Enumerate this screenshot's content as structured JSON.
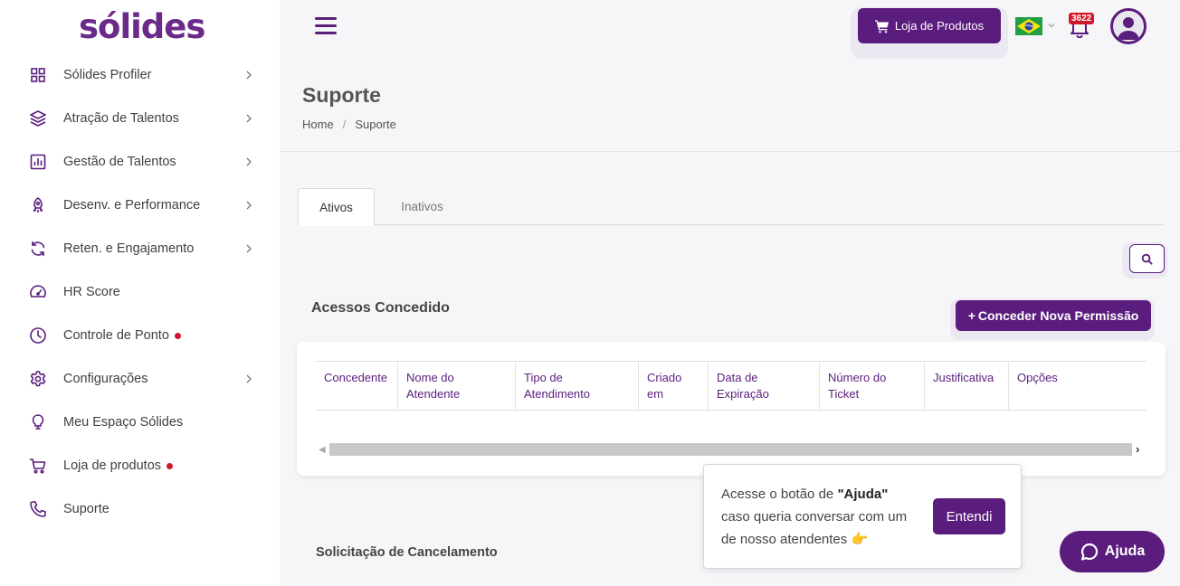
{
  "brand": {
    "logo_text": "sólides",
    "accent": "#5b1d7d"
  },
  "sidebar": {
    "items": [
      {
        "label": "Sólides Profiler",
        "icon": "grid-icon",
        "has_submenu": true
      },
      {
        "label": "Atração de Talentos",
        "icon": "layers-icon",
        "has_submenu": true
      },
      {
        "label": "Gestão de Talentos",
        "icon": "bar-chart-icon",
        "has_submenu": true
      },
      {
        "label": "Desenv. e Performance",
        "icon": "rocket-icon",
        "has_submenu": true
      },
      {
        "label": "Reten. e Engajamento",
        "icon": "refresh-icon",
        "has_submenu": true
      },
      {
        "label": "HR Score",
        "icon": "gauge-icon",
        "has_submenu": false
      },
      {
        "label": "Controle de Ponto",
        "icon": "clock-icon",
        "has_submenu": false,
        "dot": true
      },
      {
        "label": "Configurações",
        "icon": "gear-icon",
        "has_submenu": true
      },
      {
        "label": "Meu Espaço Sólides",
        "icon": "lightbulb-icon",
        "has_submenu": false
      },
      {
        "label": "Loja de produtos",
        "icon": "cart-icon",
        "has_submenu": false,
        "dot": true
      },
      {
        "label": "Suporte",
        "icon": "phone-icon",
        "has_submenu": false
      }
    ]
  },
  "topbar": {
    "shop_label": "Loja de Produtos",
    "notification_count": "3622"
  },
  "header": {
    "title": "Suporte",
    "breadcrumb": [
      "Home",
      "Suporte"
    ]
  },
  "tabs": [
    {
      "label": "Ativos",
      "active": true
    },
    {
      "label": "Inativos",
      "active": false
    }
  ],
  "access": {
    "title": "Acessos Concedido",
    "grant_label": "Conceder Nova Permissão",
    "columns": [
      {
        "l1": "Concedente",
        "l2": ""
      },
      {
        "l1": "Nome do",
        "l2": "Atendente"
      },
      {
        "l1": "Tipo de",
        "l2": "Atendimento"
      },
      {
        "l1": "Criado",
        "l2": "em"
      },
      {
        "l1": "Data de",
        "l2": "Expiração"
      },
      {
        "l1": "Número do",
        "l2": "Ticket"
      },
      {
        "l1": "Justificativa",
        "l2": ""
      },
      {
        "l1": "Opções",
        "l2": ""
      }
    ]
  },
  "cancel_section": {
    "title": "Solicitação de Cancelamento"
  },
  "popup": {
    "text_before": "Acesse o botão de ",
    "bold": "\"Ajuda\"",
    "text_after": " caso queria conversar com um de nosso atendentes 👉",
    "button_label": "Entendi"
  },
  "help": {
    "label": "Ajuda"
  }
}
